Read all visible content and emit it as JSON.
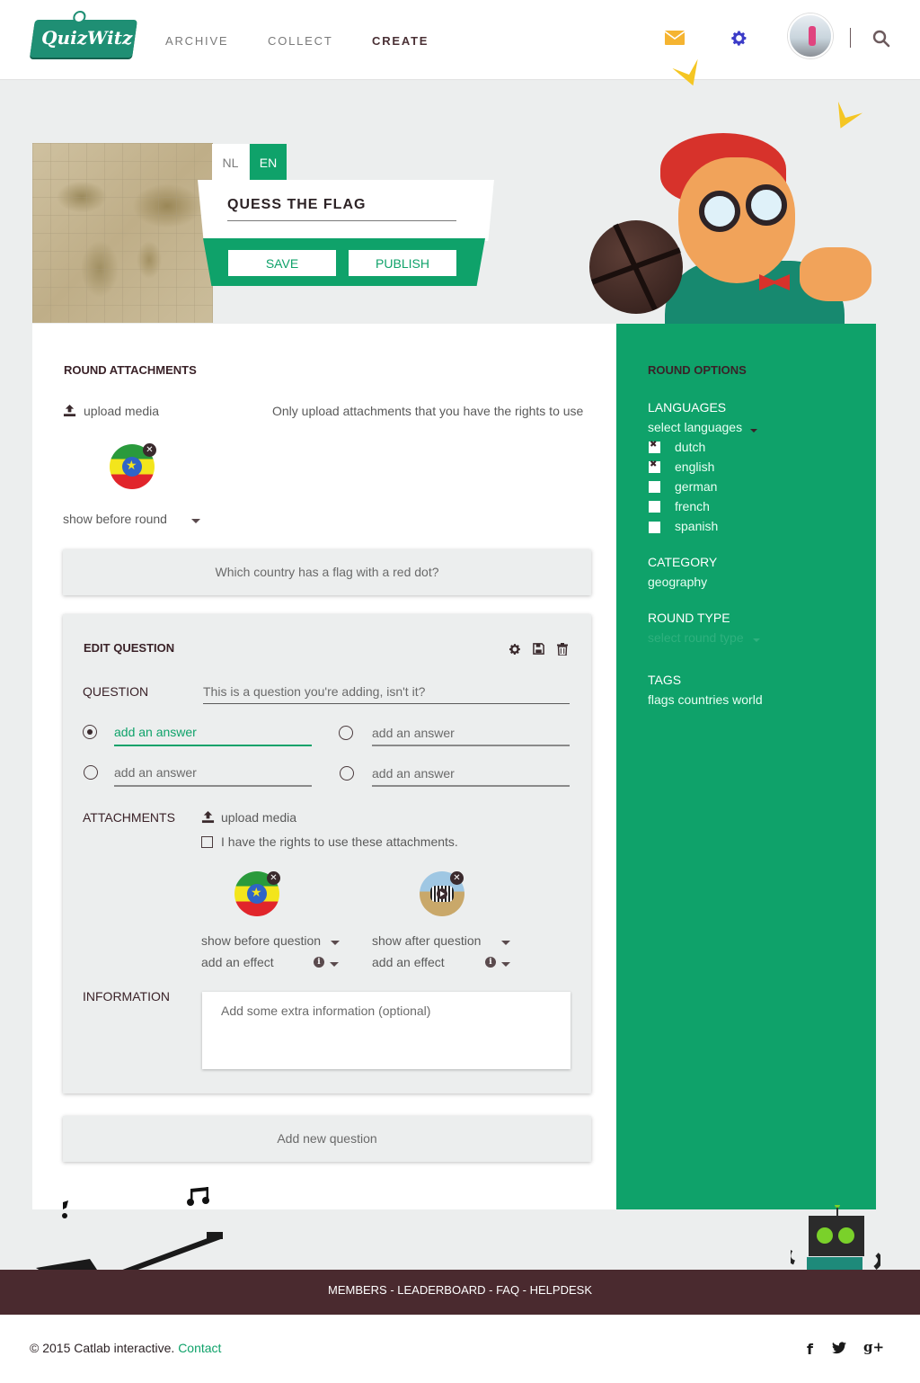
{
  "header": {
    "logo_text": "QuizWitz",
    "nav": [
      "ARCHIVE",
      "COLLECT",
      "CREATE"
    ],
    "active_nav": "CREATE"
  },
  "hero": {
    "lang_tabs": [
      "NL",
      "EN"
    ],
    "active_lang": "EN",
    "quiz_title": "QUESS THE FLAG",
    "save_label": "SAVE",
    "publish_label": "PUBLISH"
  },
  "round_attachments": {
    "heading": "ROUND ATTACHMENTS",
    "upload_label": "upload media",
    "rights_notice": "Only upload attachments that you have the rights to use",
    "show_select": "show before round"
  },
  "question_collapsed": {
    "text": "Which country has a flag with a red dot?"
  },
  "edit_question": {
    "heading": "EDIT QUESTION",
    "question_label": "QUESTION",
    "question_value": "This is a question you're adding, isn't it?",
    "answers": [
      "add an answer",
      "add an answer",
      "add an answer",
      "add an answer"
    ],
    "selected_answer": 0,
    "attachments_label": "ATTACHMENTS",
    "upload_label": "upload media",
    "rights_checkbox": "I have the rights to use these attachments.",
    "attachment1": {
      "show": "show before question",
      "effect": "add an effect"
    },
    "attachment2": {
      "show": "show after question",
      "effect": "add an effect"
    },
    "information_label": "INFORMATION",
    "information_placeholder": "Add some extra information (optional)"
  },
  "add_question_label": "Add new question",
  "round_options": {
    "heading": "ROUND OPTIONS",
    "languages_label": "LANGUAGES",
    "languages_select": "select languages",
    "languages": [
      {
        "name": "dutch",
        "checked": true
      },
      {
        "name": "english",
        "checked": true
      },
      {
        "name": "german",
        "checked": false
      },
      {
        "name": "french",
        "checked": false
      },
      {
        "name": "spanish",
        "checked": false
      }
    ],
    "category_label": "CATEGORY",
    "category_value": "geography",
    "round_type_label": "ROUND TYPE",
    "round_type_placeholder": "select round type",
    "tags_label": "TAGS",
    "tags_value": "flags countries world"
  },
  "footer": {
    "links": "MEMBERS - LEADERBOARD - FAQ - HELPDESK",
    "copyright": "© 2015 Catlab interactive.",
    "contact": "Contact"
  },
  "colors": {
    "brand_green": "#0fa26a",
    "dark": "#4a2a2f",
    "mail_icon": "#f5b431",
    "gear_icon": "#3c3cc8"
  }
}
